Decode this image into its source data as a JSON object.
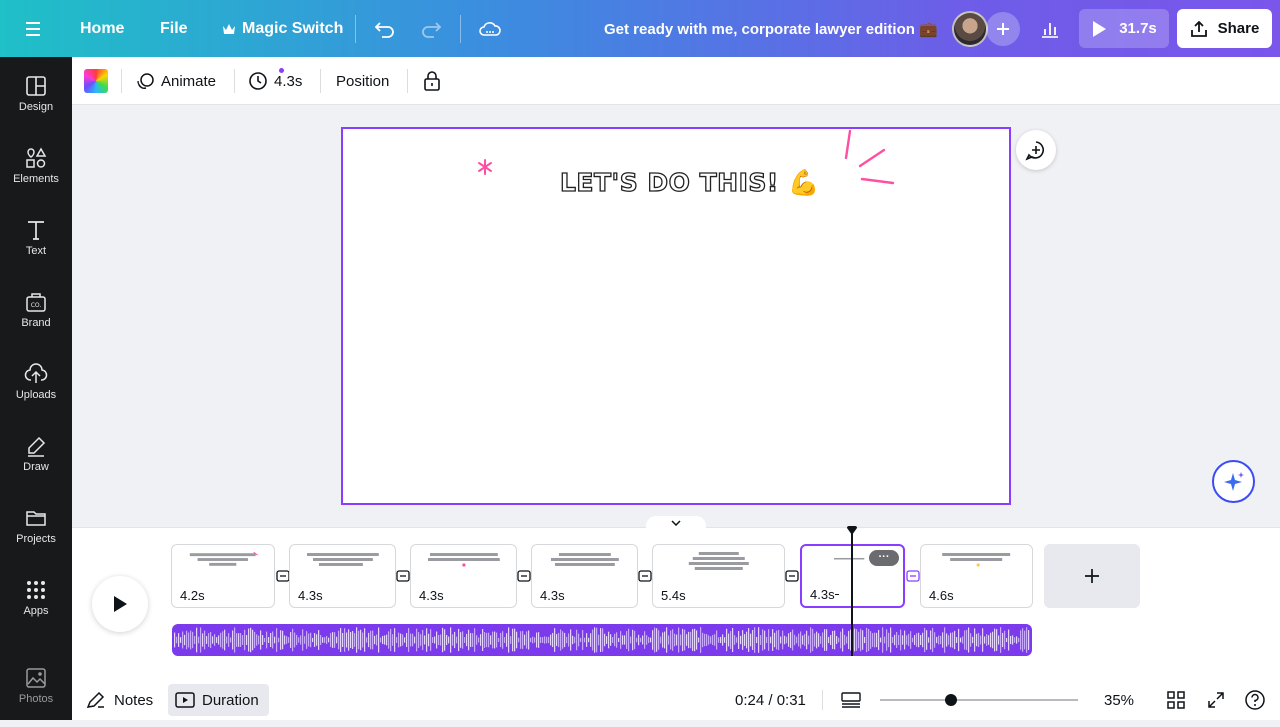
{
  "topbar": {
    "home": "Home",
    "file": "File",
    "magic_switch": "Magic Switch",
    "title": "Get ready with me, corporate lawyer edition 💼",
    "play_duration": "31.7s",
    "share": "Share"
  },
  "sidebar": {
    "items": [
      {
        "label": "Design",
        "icon": "layout-icon"
      },
      {
        "label": "Elements",
        "icon": "shapes-icon"
      },
      {
        "label": "Text",
        "icon": "text-icon"
      },
      {
        "label": "Brand",
        "icon": "brand-icon"
      },
      {
        "label": "Uploads",
        "icon": "cloud-upload-icon"
      },
      {
        "label": "Draw",
        "icon": "pen-icon"
      },
      {
        "label": "Projects",
        "icon": "folder-icon"
      },
      {
        "label": "Apps",
        "icon": "grid-icon"
      },
      {
        "label": "Photos",
        "icon": "image-icon"
      }
    ]
  },
  "toolbar": {
    "animate": "Animate",
    "duration": "4.3s",
    "position": "Position"
  },
  "canvas": {
    "headline": "LET'S DO THIS! 💪",
    "accent_color": "#ff4fa3"
  },
  "timeline": {
    "thumbnails": [
      {
        "duration": "4.2s"
      },
      {
        "duration": "4.3s"
      },
      {
        "duration": "4.3s"
      },
      {
        "duration": "4.3s"
      },
      {
        "duration": "5.4s"
      },
      {
        "duration": "4.3s"
      },
      {
        "duration": "4.6s"
      }
    ],
    "add_page": "+",
    "more": "···"
  },
  "footer": {
    "notes": "Notes",
    "duration": "Duration",
    "time": "0:24 / 0:31",
    "zoom": "35%",
    "zoom_level": 0.35
  },
  "colors": {
    "accent": "#8b3dff",
    "sidebar_bg": "#18191b",
    "audio_track": "#7c3aed"
  }
}
